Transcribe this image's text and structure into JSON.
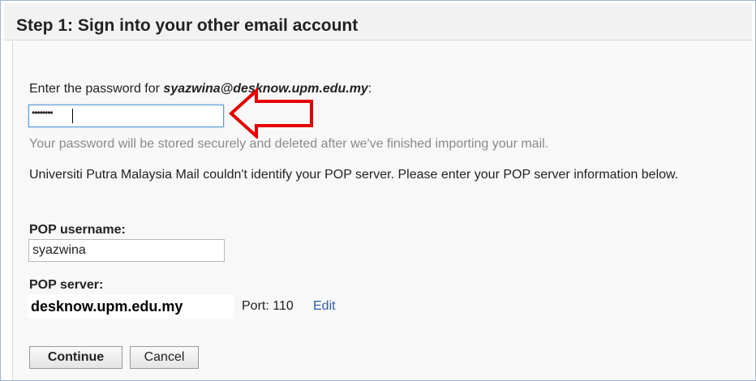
{
  "header": {
    "title": "Step 1: Sign into your other email account"
  },
  "password": {
    "label_prefix": "Enter the password for ",
    "email": "syazwina@desknow.upm.edu.my",
    "label_suffix": ":",
    "masked_value": "••••••••",
    "hint": "Your password will be stored securely and deleted after we've finished importing your mail."
  },
  "info": {
    "text": "Universiti Putra Malaysia Mail couldn't identify your POP server. Please enter your POP server information below."
  },
  "pop_username": {
    "label": "POP username:",
    "value": "syazwina"
  },
  "pop_server": {
    "label": "POP server:",
    "value": "desknow.upm.edu.my",
    "port_label": "Port: 110",
    "edit_label": "Edit"
  },
  "buttons": {
    "continue_label": "Continue",
    "cancel_label": "Cancel"
  },
  "colors": {
    "annotation_arrow": "#e60000",
    "link": "#2f5ea8"
  },
  "icons": {
    "annotation": "red-arrow-icon"
  }
}
